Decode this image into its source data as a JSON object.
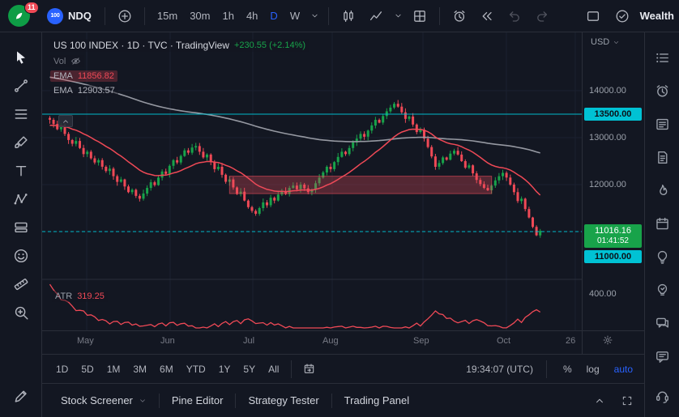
{
  "ui": {
    "accent": "#2962ff"
  },
  "topbar": {
    "notification_count": "11",
    "symbol_badge": "100",
    "symbol": "NDQ",
    "timeframes": [
      "15m",
      "30m",
      "1h",
      "4h",
      "D",
      "W"
    ],
    "active_timeframe": "D",
    "style_icons": [
      "candles-icon",
      "line-chart-icon",
      "chevron-down-icon",
      "layout-grid-icon"
    ],
    "action_icons": [
      "alert-clock-icon",
      "replay-icon",
      "undo-icon",
      "redo-icon"
    ],
    "right_icons": [
      "window-icon",
      "cloud-check-icon"
    ],
    "account_label": "Wealth"
  },
  "left_toolbar": {
    "icons": [
      "cursor-icon",
      "trend-line-icon",
      "fib-retracement-icon",
      "brush-icon",
      "text-icon",
      "xabcd-pattern-icon",
      "long-position-icon",
      "emoji-icon",
      "ruler-icon",
      "zoom-icon",
      "edit-pencil-icon"
    ]
  },
  "right_toolbar": {
    "icons": [
      "watchlist-icon",
      "alerts-icon",
      "screener-icon",
      "notes-icon",
      "hotlists-icon",
      "calendar-icon",
      "ideas-icon",
      "streams-icon",
      "chat-icon",
      "messages-icon",
      "help-icon"
    ]
  },
  "legend": {
    "title": "US 100 INDEX · 1D · TVC · TradingView",
    "change": "+230.55 (+2.14%)",
    "vol_label": "Vol",
    "ema1_label": "EMA",
    "ema1_value": "11856.82",
    "ema2_label": "EMA",
    "ema2_value": "12903.57"
  },
  "atr": {
    "label": "ATR",
    "value": "319.25"
  },
  "price_axis": {
    "currency": "USD",
    "labels": [
      {
        "text": "14000.00",
        "price": 14000
      },
      {
        "text": "13000.00",
        "price": 13000
      },
      {
        "text": "12000.00",
        "price": 12000
      }
    ],
    "line_badges": [
      {
        "text": "13500.00",
        "price": 13500
      }
    ],
    "current_badge": {
      "price_text": "11016.16",
      "countdown": "01:41:52",
      "price": 11016.16
    },
    "level_badge": {
      "text": "11000.00",
      "price": 11000
    },
    "atr_label": {
      "text": "400.00",
      "value": 400
    }
  },
  "time_axis": {
    "ticks": [
      {
        "label": "May",
        "f": 0.083
      },
      {
        "label": "Jun",
        "f": 0.237
      },
      {
        "label": "Jul",
        "f": 0.39
      },
      {
        "label": "Aug",
        "f": 0.537
      },
      {
        "label": "Sep",
        "f": 0.706
      },
      {
        "label": "Oct",
        "f": 0.86
      },
      {
        "label": "26",
        "f": 0.988
      }
    ]
  },
  "range_toolbar": {
    "ranges": [
      "1D",
      "5D",
      "1M",
      "3M",
      "6M",
      "YTD",
      "1Y",
      "5Y",
      "All"
    ],
    "time": "19:34:07 (UTC)",
    "percent": "%",
    "log": "log",
    "auto": "auto"
  },
  "bottom_tabs": {
    "tabs": [
      "Stock Screener",
      "Pine Editor",
      "Strategy Tester",
      "Trading Panel"
    ],
    "dropdown_tab": "Stock Screener"
  },
  "chart_data": {
    "type": "candlestick",
    "symbol": "US 100 INDEX",
    "timeframe": "1D",
    "title": "US 100 INDEX · 1D · TVC · TradingView",
    "last_price": 11016.16,
    "change_text": "+230.55 (+2.14%)",
    "ylim": [
      9980,
      15240
    ],
    "first_open": 13420,
    "closes": [
      13380,
      13290,
      13180,
      13240,
      13080,
      12950,
      12870,
      12930,
      12780,
      12650,
      12700,
      12560,
      12470,
      12520,
      12380,
      12290,
      12340,
      12180,
      12060,
      12110,
      11960,
      11840,
      11890,
      11760,
      11700,
      11810,
      11930,
      12050,
      11990,
      12150,
      12280,
      12230,
      12400,
      12520,
      12470,
      12610,
      12730,
      12680,
      12790,
      12820,
      12700,
      12580,
      12640,
      12480,
      12330,
      12380,
      12210,
      12060,
      12110,
      11940,
      11800,
      11850,
      11660,
      11520,
      11440,
      11380,
      11500,
      11620,
      11560,
      11720,
      11660,
      11790,
      11860,
      11800,
      11930,
      11980,
      11900,
      12000,
      11920,
      11840,
      11900,
      12030,
      12150,
      12260,
      12380,
      12330,
      12480,
      12590,
      12700,
      12650,
      12780,
      12900,
      12980,
      13080,
      13020,
      13150,
      13260,
      13380,
      13320,
      13460,
      13560,
      13640,
      13720,
      13660,
      13540,
      13400,
      13450,
      13280,
      13120,
      13170,
      12980,
      12800,
      12600,
      12380,
      12460,
      12580,
      12530,
      12660,
      12720,
      12640,
      12500,
      12360,
      12410,
      12240,
      12100,
      12010,
      11930,
      11880,
      11980,
      12090,
      12180,
      12250,
      12150,
      12000,
      11840,
      11650,
      11700,
      11480,
      11300,
      11100,
      10920,
      11016.16
    ],
    "ema_fast": {
      "label": "EMA",
      "period": 21,
      "start": 13250,
      "last": "11856.82"
    },
    "ema_slow": {
      "label": "EMA",
      "period": 150,
      "start": 14300,
      "last": "12903.57"
    },
    "atr": {
      "label": "ATR",
      "period": 14,
      "start": 453,
      "scale": 2.16,
      "last": "319.25",
      "axis_range": [
        200,
        480
      ]
    },
    "zone": {
      "start_index": 48,
      "end_index": 118,
      "top": 12180,
      "bottom": 11810
    },
    "h_lines": [
      {
        "price": 13500,
        "style": "solid"
      },
      {
        "price": 11000,
        "style": "dashed"
      }
    ],
    "colors": {
      "up": "#18a34a",
      "down": "#ef4956",
      "ema_fast": "#ef4956",
      "ema_slow": "#9598a1",
      "level_line": "#00c2d4",
      "zone_fill": "rgba(235,77,92,0.30)",
      "zone_stroke": "rgba(235,77,92,0.60)",
      "atr_line": "#ef4956"
    }
  }
}
